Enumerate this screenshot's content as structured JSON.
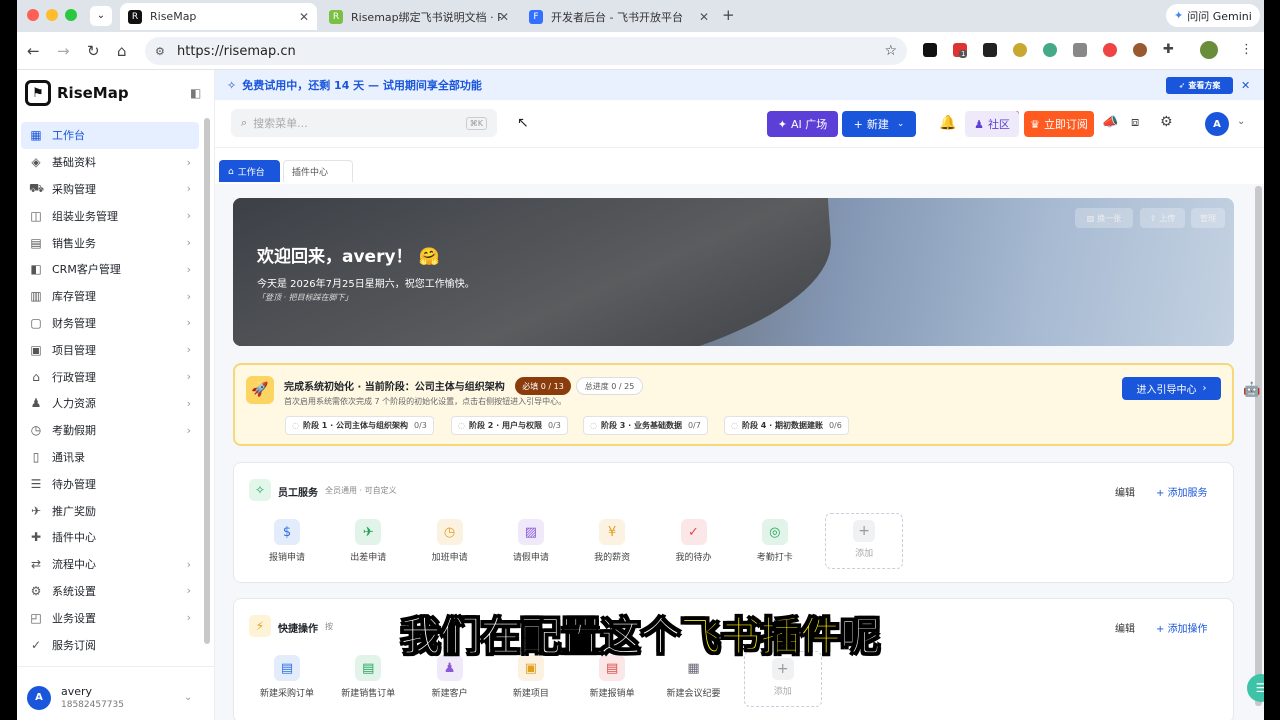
{
  "browser": {
    "tabs": [
      {
        "title": "RiseMap"
      },
      {
        "title": "Risemap绑定飞书说明文档 · R"
      },
      {
        "title": "开发者后台 - 飞书开放平台"
      }
    ],
    "url": "https://risemap.cn",
    "gemini_label": "问问 Gemini",
    "ext_badge": "1"
  },
  "sidebar": {
    "brand": "RiseMap",
    "items": [
      {
        "label": "工作台",
        "icon": "▦"
      },
      {
        "label": "基础资料",
        "icon": "◈"
      },
      {
        "label": "采购管理",
        "icon": "⛟"
      },
      {
        "label": "组装业务管理",
        "icon": "◫"
      },
      {
        "label": "销售业务",
        "icon": "▤"
      },
      {
        "label": "CRM客户管理",
        "icon": "◧"
      },
      {
        "label": "库存管理",
        "icon": "▥"
      },
      {
        "label": "财务管理",
        "icon": "▢"
      },
      {
        "label": "项目管理",
        "icon": "▣"
      },
      {
        "label": "行政管理",
        "icon": "⌂"
      },
      {
        "label": "人力资源",
        "icon": "♟"
      },
      {
        "label": "考勤假期",
        "icon": "◷"
      },
      {
        "label": "通讯录",
        "icon": "▯"
      },
      {
        "label": "待办管理",
        "icon": "☰"
      },
      {
        "label": "推广奖励",
        "icon": "✈"
      },
      {
        "label": "插件中心",
        "icon": "✚"
      },
      {
        "label": "流程中心",
        "icon": "⇄"
      },
      {
        "label": "系统设置",
        "icon": "⚙"
      },
      {
        "label": "业务设置",
        "icon": "◰"
      },
      {
        "label": "服务订阅",
        "icon": "✓"
      }
    ],
    "user_name": "avery",
    "user_phone": "18582457735",
    "user_initial": "A"
  },
  "trial_banner": {
    "text": "免费试用中，还剩 14 天 — 试用期间享全部功能",
    "button": "查看方案"
  },
  "topbar": {
    "search_placeholder": "搜索菜单...",
    "shortcut": "⌘K",
    "ai_button": "AI 广场",
    "new_button": "新建",
    "community": "社区",
    "subscribe": "立即订阅",
    "avatar": "A"
  },
  "page_tabs": [
    "工作台",
    "插件中心"
  ],
  "hero": {
    "greeting": "欢迎回来，avery！ 🤗",
    "date_line": "今天是 2026年7月25日星期六，祝您工作愉快。",
    "motto": "「登顶 · 把目标踩在脚下」",
    "buttons": [
      "换一张",
      "上传",
      "管理"
    ]
  },
  "init": {
    "title": "完成系统初始化 · 当前阶段：公司主体与组织架构",
    "required": "必填 0 / 13",
    "total": "总进度 0 / 25",
    "desc": "首次启用系统需依次完成 7 个阶段的初始化设置，点击右侧按钮进入引导中心。",
    "cta": "进入引导中心",
    "stages": [
      {
        "label": "阶段 1 · 公司主体与组织架构",
        "count": "0/3"
      },
      {
        "label": "阶段 2 · 用户与权限",
        "count": "0/3"
      },
      {
        "label": "阶段 3 · 业务基础数据",
        "count": "0/7"
      },
      {
        "label": "阶段 4 · 期初数据建账",
        "count": "0/6"
      }
    ]
  },
  "employee": {
    "title": "员工服务",
    "subtitle": "全员通用 · 可自定义",
    "edit": "编辑",
    "add": "添加服务",
    "items": [
      {
        "label": "报销申请",
        "icon": "$",
        "color": "#2f6fe4"
      },
      {
        "label": "出差申请",
        "icon": "✈",
        "color": "#22a45a"
      },
      {
        "label": "加班申请",
        "icon": "◷",
        "color": "#e0a020"
      },
      {
        "label": "请假申请",
        "icon": "▨",
        "color": "#8a5ad6"
      },
      {
        "label": "我的薪资",
        "icon": "¥",
        "color": "#e0a020"
      },
      {
        "label": "我的待办",
        "icon": "✓",
        "color": "#e04a4a"
      },
      {
        "label": "考勤打卡",
        "icon": "◎",
        "color": "#22a45a"
      }
    ],
    "add_tile": "添加"
  },
  "quick": {
    "title": "快捷操作",
    "subtitle": "按",
    "edit": "编辑",
    "add": "添加操作",
    "items": [
      {
        "label": "新建采购订单",
        "icon": "▤",
        "color": "#2f6fe4"
      },
      {
        "label": "新建销售订单",
        "icon": "▤",
        "color": "#22a45a"
      },
      {
        "label": "新建客户",
        "icon": "♟",
        "color": "#8a5ad6"
      },
      {
        "label": "新建项目",
        "icon": "▣",
        "color": "#e0a020"
      },
      {
        "label": "新建报销单",
        "icon": "▤",
        "color": "#e04a4a"
      },
      {
        "label": "新建会议纪要",
        "icon": "▦",
        "color": "#667"
      }
    ],
    "add_tile": "添加"
  },
  "subtitle": {
    "before": "我们在配置这个",
    "highlight": "飞书插件",
    "after": "呢"
  },
  "colors": {
    "primary": "#1a56db",
    "ai": "#5b3fd6",
    "orange": "#ff5a1f"
  }
}
